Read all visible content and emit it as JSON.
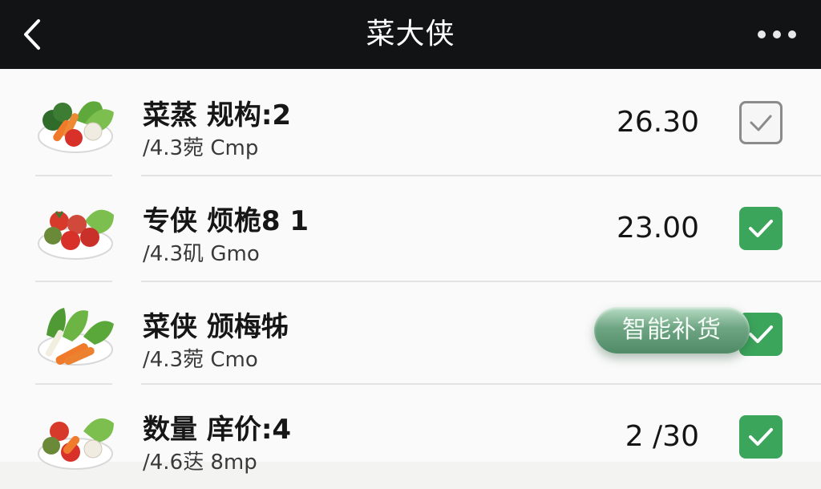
{
  "nav": {
    "title": "菜大侠",
    "back_icon": "chevron-left-icon",
    "more_icon": "more-dots-icon"
  },
  "items": [
    {
      "name": "菜蒸 规构:2",
      "sub": "/4.3菀 Cmp",
      "price": "26.30",
      "checked": false,
      "thumb_icon": "vegetable-plate-broccoli-icon"
    },
    {
      "name": "专侠 烦桅8 1",
      "sub": "/4.3矶 Gmo",
      "price": "23.00",
      "checked": true,
      "thumb_icon": "vegetable-plate-tomato-icon"
    },
    {
      "name": "菜侠 颁梅牬",
      "sub": "/4.3菀 Cmo",
      "price": "",
      "checked": true,
      "thumb_icon": "vegetable-plate-carrot-icon"
    },
    {
      "name": "数量 庠价:4",
      "sub": "/4.6荙 8mp",
      "price": "2 /30",
      "checked": true,
      "thumb_icon": "vegetable-plate-mixed-icon"
    }
  ],
  "smart_restock_label": "智能补货",
  "colors": {
    "nav_bg": "#111314",
    "checked_green": "#3ca55c",
    "pill_green": "#4f8a66",
    "unchecked_border": "#8b8b8b"
  }
}
